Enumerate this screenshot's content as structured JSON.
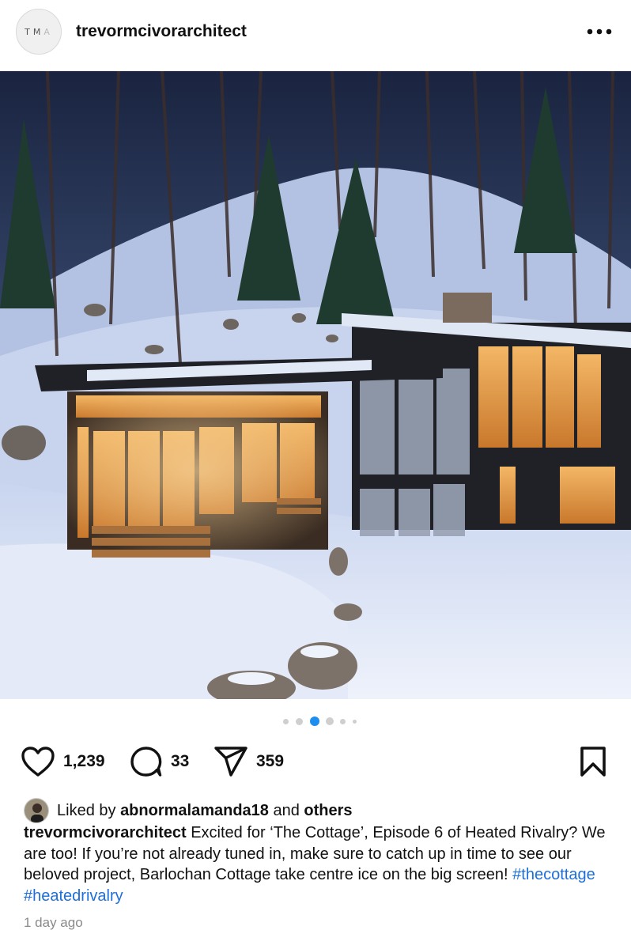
{
  "post": {
    "account": {
      "avatar_letters": [
        "T",
        "M",
        "A"
      ],
      "username": "trevormcivorarchitect"
    },
    "more_icon": "more-horizontal-icon",
    "carousel": {
      "count": 6,
      "active_index": 2
    },
    "actions": {
      "likes": "1,239",
      "comments": "33",
      "shares": "359",
      "icons": [
        "heart-icon",
        "comment-icon",
        "send-icon",
        "bookmark-icon"
      ]
    },
    "liked_by": {
      "prefix": "Liked by",
      "user": "abnormalamanda18",
      "conjunction": "and",
      "others": "others"
    },
    "caption": {
      "username": "trevormcivorarchitect",
      "text": "Excited for ‘The Cottage’, Episode 6 of Heated Rivalry? We are too! If you’re not already tuned in, make sure to catch up in time to see our beloved project, Barlochan Cottage take centre ice on the big screen!",
      "hashtags": [
        "#thecottage",
        "#heatedrivalry"
      ]
    },
    "timestamp": "1 day ago",
    "colors": {
      "link": "#1e6fd9",
      "active_dot": "#1d8ef0",
      "inactive_dot": "#cfcfcf"
    }
  }
}
